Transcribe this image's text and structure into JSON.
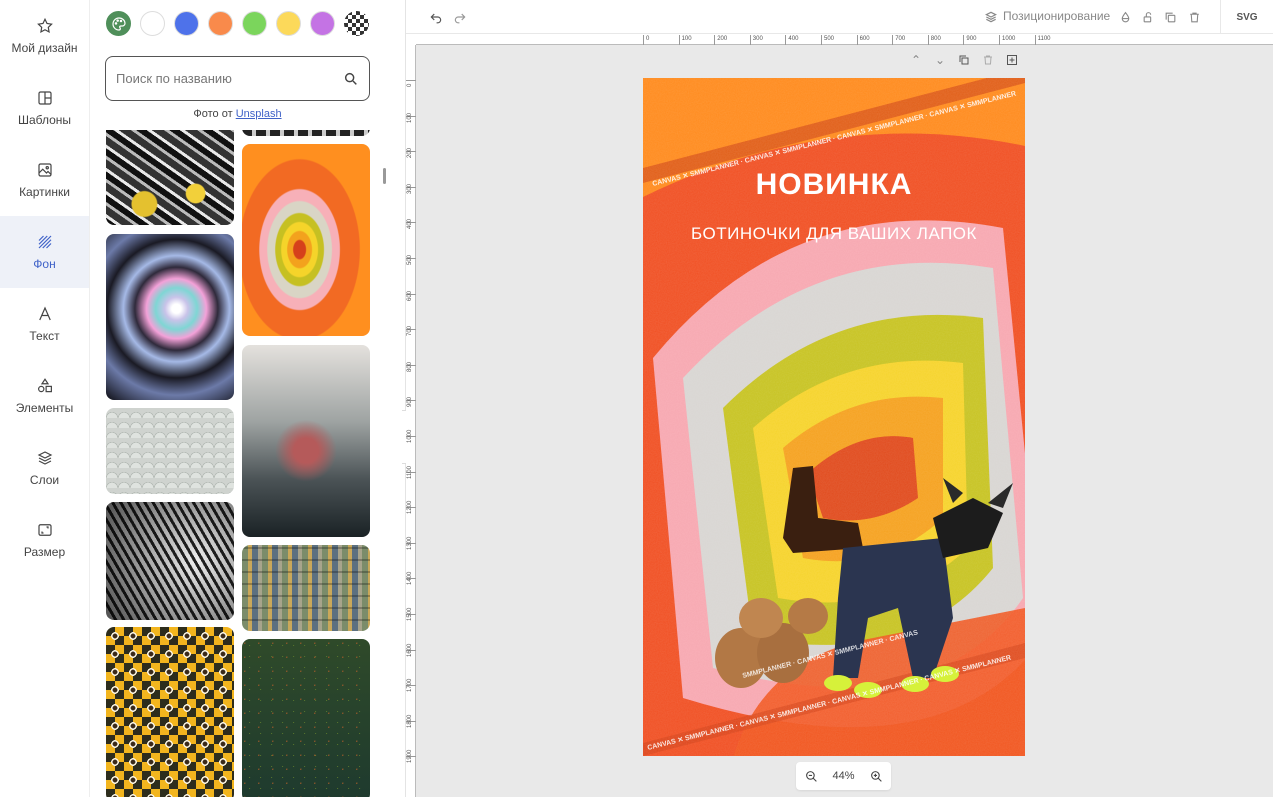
{
  "nav": {
    "items": [
      {
        "label": "Мой дизайн",
        "icon": "star-icon"
      },
      {
        "label": "Шаблоны",
        "icon": "template-icon"
      },
      {
        "label": "Картинки",
        "icon": "image-icon"
      },
      {
        "label": "Фон",
        "icon": "background-icon"
      },
      {
        "label": "Текст",
        "icon": "text-icon"
      },
      {
        "label": "Элементы",
        "icon": "shapes-icon"
      },
      {
        "label": "Слои",
        "icon": "layers-icon"
      },
      {
        "label": "Размер",
        "icon": "resize-icon"
      }
    ],
    "active": "Фон"
  },
  "panel": {
    "swatch_colors": [
      "#ffffff",
      "#4e72ea",
      "#f98a4b",
      "#7bd55c",
      "#fcd95a",
      "#c473e4"
    ],
    "search": {
      "placeholder": "Поиск по названию"
    },
    "credit": {
      "prefix": "Фото от",
      "link": "Unsplash"
    }
  },
  "toolbar": {
    "positioning_label": "Позиционирование",
    "export_label": "SVG"
  },
  "rulers": {
    "horizontal": [
      "0",
      "100",
      "200",
      "300",
      "400",
      "500",
      "600",
      "700",
      "800",
      "900",
      "1000",
      "1100"
    ],
    "vertical": [
      "0",
      "100",
      "200",
      "300",
      "400",
      "500",
      "600",
      "700",
      "800",
      "900",
      "1000",
      "1100",
      "1200",
      "1300",
      "1400",
      "1500",
      "1600",
      "1700",
      "1800",
      "1900"
    ]
  },
  "artboard": {
    "title": "НОВИНКА",
    "subtitle": "БОТИНОЧКИ ДЛЯ ВАШИХ ЛАПОК",
    "watermark": "CANVAS ✕ SMMPLANNER"
  },
  "zoom": {
    "value": "44%"
  }
}
